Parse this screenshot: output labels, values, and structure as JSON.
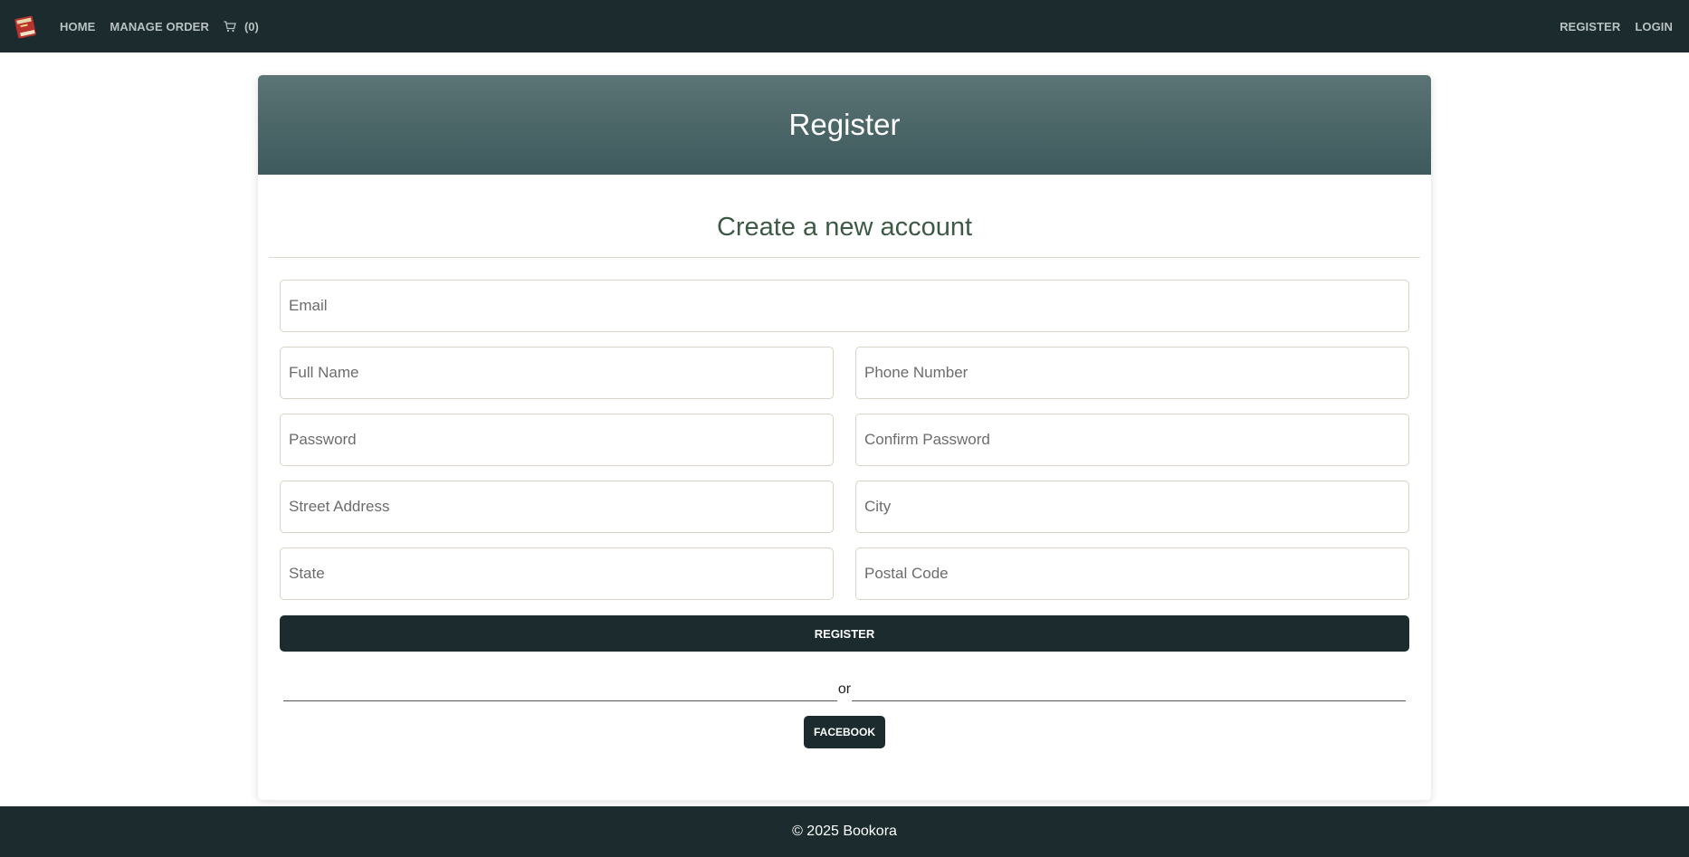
{
  "nav": {
    "logo_icon": "book-logo-icon",
    "links": {
      "home": "HOME",
      "manage_order": "MANAGE ORDER"
    },
    "cart": {
      "icon": "cart-icon",
      "count": "(0)"
    },
    "right": {
      "register": "REGISTER",
      "login": "LOGIN"
    }
  },
  "card": {
    "header_title": "Register",
    "subtitle": "Create a new account"
  },
  "form": {
    "email_placeholder": "Email",
    "full_name_placeholder": "Full Name",
    "phone_placeholder": "Phone Number",
    "password_placeholder": "Password",
    "confirm_password_placeholder": "Confirm Password",
    "street_placeholder": "Street Address",
    "city_placeholder": "City",
    "state_placeholder": "State",
    "postal_placeholder": "Postal Code",
    "submit_label": "REGISTER",
    "or_label": "or",
    "facebook_label": "FACEBOOK"
  },
  "footer": {
    "text": "© 2025 Bookora"
  },
  "colors": {
    "nav_bg": "#1b2b2e",
    "header_gradient_top": "#5b7475",
    "header_gradient_bottom": "#3e5a5c",
    "subtitle": "#3d5a45",
    "button_bg": "#1b2b2e"
  }
}
